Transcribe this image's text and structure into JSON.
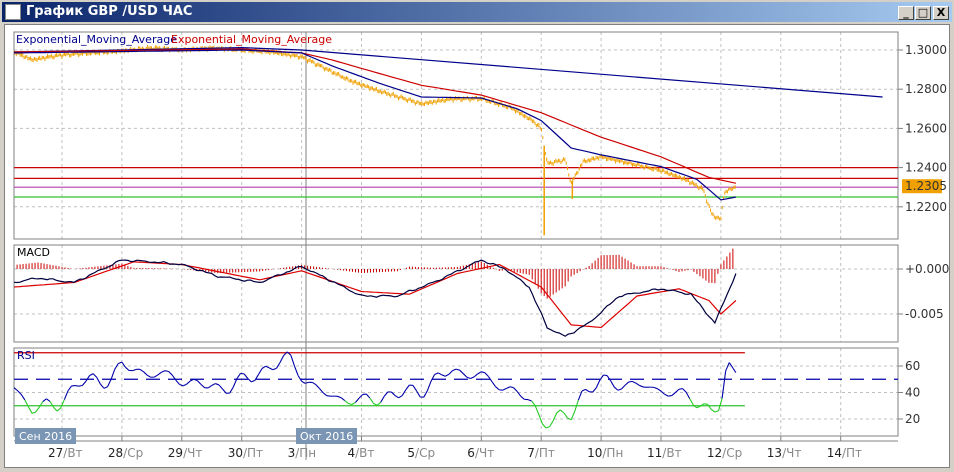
{
  "window": {
    "title": "График GBP /USD  ЧАС",
    "buttons": {
      "minimize": "_",
      "maximize": "□",
      "close": "X"
    }
  },
  "colors": {
    "price": "#f0a000",
    "ema_long": "#00008b",
    "ema_short_blue": "#00008b",
    "ema_red": "#cc0000",
    "macd": "#000040",
    "signal": "#dd0000",
    "histogram": "#cc0000",
    "rsi": "#0000aa",
    "rsi_low": "#22cc22",
    "level_red": "#cc0000",
    "level_magenta": "#b040b0",
    "level_green": "#30c030",
    "price_tag": "#f0a000",
    "month_badge": "#7a96b4"
  },
  "chart_data": [
    {
      "type": "line",
      "panel": "price",
      "title": "GBP/USD H1",
      "legend": [
        "Exponential_Moving_Average",
        "Exponential_Moving_Average"
      ],
      "ylim": [
        1.204,
        1.308
      ],
      "y_ticks": [
        "1.3000",
        "1.2800",
        "1.2600",
        "1.2400",
        "1.2200"
      ],
      "y_tick_values": [
        1.3,
        1.28,
        1.26,
        1.24,
        1.22
      ],
      "current_price": "1.2305",
      "horizontal_levels": [
        {
          "value": 1.24,
          "color": "#cc0000"
        },
        {
          "value": 1.2345,
          "color": "#cc0000"
        },
        {
          "value": 1.23,
          "color": "#b040b0"
        },
        {
          "value": 1.225,
          "color": "#30c030"
        }
      ],
      "price_keypoints": [
        [
          0.2,
          1.299
        ],
        [
          0.5,
          1.295
        ],
        [
          1,
          1.2975
        ],
        [
          1.5,
          1.2985
        ],
        [
          2,
          1.2995
        ],
        [
          2.5,
          1.301
        ],
        [
          3,
          1.3
        ],
        [
          3.5,
          1.301
        ],
        [
          4,
          1.3
        ],
        [
          4.5,
          1.299
        ],
        [
          5,
          1.2965
        ],
        [
          5.3,
          1.292
        ],
        [
          5.8,
          1.2845
        ],
        [
          6.3,
          1.279
        ],
        [
          7,
          1.2725
        ],
        [
          7.5,
          1.275
        ],
        [
          8,
          1.2752
        ],
        [
          8.5,
          1.2705
        ],
        [
          8.85,
          1.264
        ],
        [
          9.0,
          1.26
        ],
        [
          9.1,
          1.242
        ],
        [
          9.4,
          1.244
        ],
        [
          9.5,
          1.232
        ],
        [
          9.7,
          1.243
        ],
        [
          10,
          1.2455
        ],
        [
          10.5,
          1.242
        ],
        [
          11,
          1.2385
        ],
        [
          11.4,
          1.234
        ],
        [
          11.7,
          1.229
        ],
        [
          11.85,
          1.216
        ],
        [
          12.0,
          1.2135
        ],
        [
          12.05,
          1.227
        ],
        [
          12.25,
          1.2305
        ]
      ],
      "spikes": [
        [
          9.05,
          1.2055
        ],
        [
          9.52,
          1.224
        ]
      ],
      "ema_long": [
        [
          0.2,
          1.299
        ],
        [
          2,
          1.3
        ],
        [
          4,
          1.3012
        ],
        [
          5,
          1.3
        ],
        [
          14.7,
          1.276
        ]
      ],
      "ema_short": [
        [
          0.2,
          1.2985
        ],
        [
          4,
          1.3
        ],
        [
          5,
          1.2985
        ],
        [
          5.5,
          1.292
        ],
        [
          6.3,
          1.283
        ],
        [
          7,
          1.276
        ],
        [
          8,
          1.2755
        ],
        [
          8.6,
          1.27
        ],
        [
          9,
          1.264
        ],
        [
          9.5,
          1.25
        ],
        [
          10,
          1.2465
        ],
        [
          11,
          1.2405
        ],
        [
          11.6,
          1.234
        ],
        [
          12,
          1.2235
        ],
        [
          12.25,
          1.225
        ]
      ],
      "ema_red": [
        [
          0.2,
          1.299
        ],
        [
          4,
          1.3005
        ],
        [
          5,
          1.2985
        ],
        [
          5.5,
          1.295
        ],
        [
          6.3,
          1.288
        ],
        [
          7,
          1.282
        ],
        [
          8,
          1.277
        ],
        [
          9,
          1.268
        ],
        [
          10,
          1.2555
        ],
        [
          11,
          1.2455
        ],
        [
          11.8,
          1.235
        ],
        [
          12.25,
          1.232
        ]
      ]
    },
    {
      "type": "bar+line",
      "panel": "macd",
      "title": "MACD",
      "ylim": [
        -0.0085,
        0.0025
      ],
      "y_ticks": [
        "+0.000",
        "-0.005"
      ],
      "y_tick_values": [
        0.0,
        -0.005
      ],
      "macd": [
        [
          0.2,
          -0.0015
        ],
        [
          0.6,
          -0.001
        ],
        [
          1.2,
          -0.0015
        ],
        [
          2,
          0.001
        ],
        [
          2.5,
          0.0008
        ],
        [
          3,
          0.0005
        ],
        [
          3.6,
          -0.0008
        ],
        [
          4.3,
          -0.0015
        ],
        [
          5,
          0.0003
        ],
        [
          5.4,
          -0.001
        ],
        [
          6,
          -0.003
        ],
        [
          6.6,
          -0.003
        ],
        [
          7.2,
          -0.0015
        ],
        [
          8,
          0.001
        ],
        [
          8.4,
          0.0
        ],
        [
          8.8,
          -0.002
        ],
        [
          9.1,
          -0.0065
        ],
        [
          9.4,
          -0.0075
        ],
        [
          9.8,
          -0.006
        ],
        [
          10.3,
          -0.003
        ],
        [
          11,
          -0.0022
        ],
        [
          11.5,
          -0.0028
        ],
        [
          11.9,
          -0.006
        ],
        [
          12.25,
          -0.0005
        ]
      ],
      "signal": [
        [
          0.2,
          -0.002
        ],
        [
          1.2,
          -0.0015
        ],
        [
          2.2,
          0.0008
        ],
        [
          3,
          0.0005
        ],
        [
          4.3,
          -0.0012
        ],
        [
          5,
          -0.0002
        ],
        [
          6,
          -0.0025
        ],
        [
          6.8,
          -0.0028
        ],
        [
          7.6,
          -0.0005
        ],
        [
          8.3,
          0.0005
        ],
        [
          9,
          -0.002
        ],
        [
          9.5,
          -0.0062
        ],
        [
          10,
          -0.0065
        ],
        [
          10.6,
          -0.003
        ],
        [
          11.3,
          -0.0022
        ],
        [
          11.8,
          -0.0035
        ],
        [
          12,
          -0.005
        ],
        [
          12.25,
          -0.0035
        ]
      ]
    },
    {
      "type": "line",
      "panel": "rsi",
      "title": "RSI",
      "ylim": [
        8,
        72
      ],
      "y_ticks": [
        "60",
        "40",
        "20"
      ],
      "y_tick_values": [
        60,
        40,
        20
      ],
      "levels": {
        "upper": 70,
        "middle": 50,
        "lower": 30
      },
      "rsi": [
        [
          0.2,
          44
        ],
        [
          0.5,
          28
        ],
        [
          0.9,
          30
        ],
        [
          1.3,
          48
        ],
        [
          1.8,
          50
        ],
        [
          2,
          60
        ],
        [
          2.4,
          55
        ],
        [
          2.8,
          52
        ],
        [
          3.2,
          47
        ],
        [
          3.6,
          43
        ],
        [
          4,
          48
        ],
        [
          4.5,
          60
        ],
        [
          4.8,
          66
        ],
        [
          5.05,
          50
        ],
        [
          5.4,
          38
        ],
        [
          6,
          33
        ],
        [
          6.5,
          38
        ],
        [
          7,
          42
        ],
        [
          7.5,
          57
        ],
        [
          8,
          52
        ],
        [
          8.5,
          42
        ],
        [
          8.8,
          34
        ],
        [
          9.0,
          20
        ],
        [
          9.2,
          18
        ],
        [
          9.5,
          24
        ],
        [
          9.7,
          40
        ],
        [
          10,
          48
        ],
        [
          10.5,
          46
        ],
        [
          11,
          42
        ],
        [
          11.5,
          36
        ],
        [
          11.85,
          26
        ],
        [
          12.0,
          30
        ],
        [
          12.1,
          58
        ],
        [
          12.25,
          55
        ]
      ]
    }
  ],
  "time_axis": {
    "months": [
      {
        "label": "Сен 2016",
        "day": 0.2
      },
      {
        "label": "Окт 2016",
        "day": 5
      }
    ],
    "days": [
      {
        "num": "27",
        "wd": "/Вт"
      },
      {
        "num": "28",
        "wd": "/Ср"
      },
      {
        "num": "29",
        "wd": "/Чт"
      },
      {
        "num": "30",
        "wd": "/Пт"
      },
      {
        "num": "3",
        "wd": "/Пн"
      },
      {
        "num": "4",
        "wd": "/Вт"
      },
      {
        "num": "5",
        "wd": "/Ср"
      },
      {
        "num": "6",
        "wd": "/Чт"
      },
      {
        "num": "7",
        "wd": "/Пт"
      },
      {
        "num": "10",
        "wd": "/Пн"
      },
      {
        "num": "11",
        "wd": "/Вт"
      },
      {
        "num": "12",
        "wd": "/Ср"
      },
      {
        "num": "13",
        "wd": "/Чт"
      },
      {
        "num": "14",
        "wd": "/Пт"
      }
    ]
  }
}
